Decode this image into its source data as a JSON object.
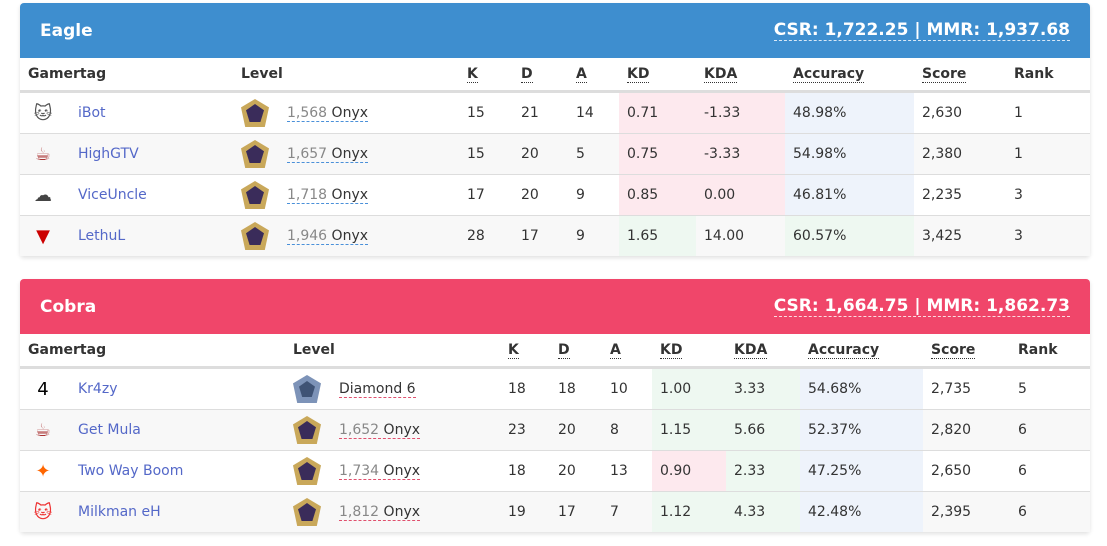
{
  "colors": {
    "eagle": "#3e8ecf",
    "cobra": "#f0466a",
    "link": "#5468c8"
  },
  "headers": [
    "Gamertag",
    "Level",
    "K",
    "D",
    "A",
    "KD",
    "KDA",
    "Accuracy",
    "Score",
    "Rank"
  ],
  "teams": [
    {
      "name": "Eagle",
      "stats": "CSR: 1,722.25 | MMR: 1,937.68",
      "players": [
        {
          "avatar": "cat-icon",
          "gamertag": "iBot",
          "level_num": "1,568",
          "level_tier": "Onyx",
          "k": "15",
          "d": "21",
          "a": "14",
          "kd": "0.71",
          "kda": "-1.33",
          "accuracy": "48.98%",
          "score": "2,630",
          "rank": "1"
        },
        {
          "avatar": "cup-icon",
          "gamertag": "HighGTV",
          "level_num": "1,657",
          "level_tier": "Onyx",
          "k": "15",
          "d": "20",
          "a": "5",
          "kd": "0.75",
          "kda": "-3.33",
          "accuracy": "54.98%",
          "score": "2,380",
          "rank": "1"
        },
        {
          "avatar": "cloud9-icon",
          "gamertag": "ViceUncle",
          "level_num": "1,718",
          "level_tier": "Onyx",
          "k": "17",
          "d": "20",
          "a": "9",
          "kd": "0.85",
          "kda": "0.00",
          "accuracy": "46.81%",
          "score": "2,235",
          "rank": "3"
        },
        {
          "avatar": "sentinels-icon",
          "gamertag": "LethuL",
          "level_num": "1,946",
          "level_tier": "Onyx",
          "k": "28",
          "d": "17",
          "a": "9",
          "kd": "1.65",
          "kda": "14.00",
          "accuracy": "60.57%",
          "score": "3,425",
          "rank": "3"
        }
      ]
    },
    {
      "name": "Cobra",
      "stats": "CSR: 1,664.75 | MMR: 1,862.73",
      "players": [
        {
          "avatar": "number-4-icon",
          "gamertag": "Kr4zy",
          "level_num": "",
          "level_tier": "Diamond 6",
          "k": "18",
          "d": "18",
          "a": "10",
          "kd": "1.00",
          "kda": "3.33",
          "accuracy": "54.68%",
          "score": "2,735",
          "rank": "5"
        },
        {
          "avatar": "cup-icon",
          "gamertag": "Get Mula",
          "level_num": "1,652",
          "level_tier": "Onyx",
          "k": "23",
          "d": "20",
          "a": "8",
          "kd": "1.15",
          "kda": "5.66",
          "accuracy": "52.37%",
          "score": "2,820",
          "rank": "6"
        },
        {
          "avatar": "fnatic-icon",
          "gamertag": "Two Way Boom",
          "level_num": "1,734",
          "level_tier": "Onyx",
          "k": "18",
          "d": "20",
          "a": "13",
          "kd": "0.90",
          "kda": "2.33",
          "accuracy": "47.25%",
          "score": "2,650",
          "rank": "6"
        },
        {
          "avatar": "red-cat-icon",
          "gamertag": "Milkman eH",
          "level_num": "1,812",
          "level_tier": "Onyx",
          "k": "19",
          "d": "17",
          "a": "7",
          "kd": "1.12",
          "kda": "4.33",
          "accuracy": "42.48%",
          "score": "2,395",
          "rank": "6"
        }
      ]
    }
  ]
}
